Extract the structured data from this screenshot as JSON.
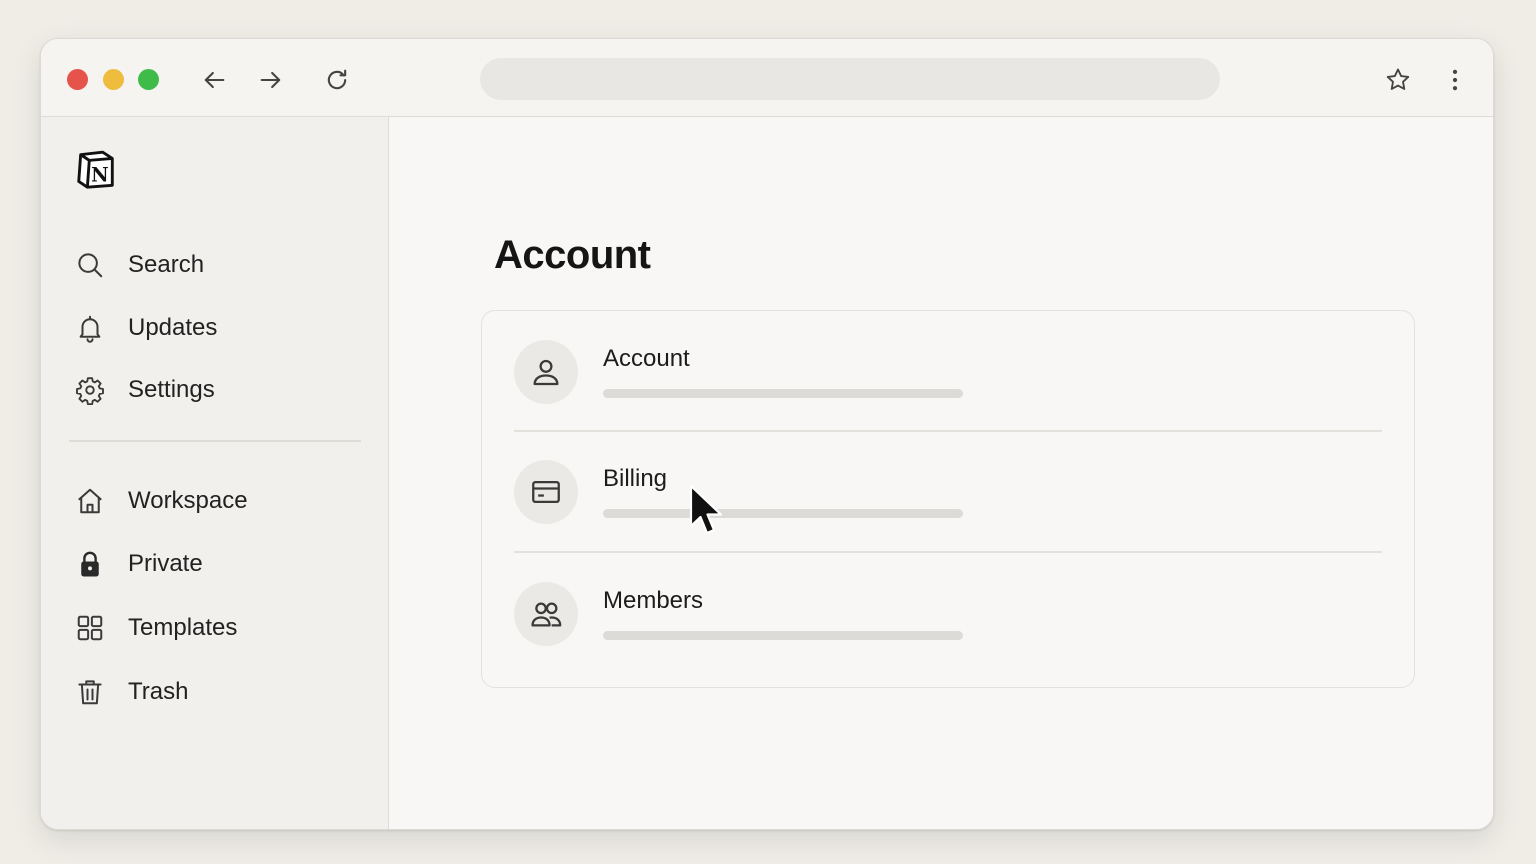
{
  "browser": {
    "traffic_lights": {
      "close": "#e5534b",
      "minimize": "#efbd3e",
      "maximize": "#3fbb4a"
    },
    "url": "",
    "icons": [
      "back-arrow-icon",
      "forward-arrow-icon",
      "reload-icon",
      "star-icon",
      "more-vertical-icon"
    ]
  },
  "sidebar": {
    "logo": "notion-logo",
    "top_items": [
      {
        "label": "Search",
        "icon": "search-icon"
      },
      {
        "label": "Updates",
        "icon": "bell-icon"
      },
      {
        "label": "Settings",
        "icon": "gear-icon"
      }
    ],
    "items": [
      {
        "label": "Workspace",
        "icon": "home-icon"
      },
      {
        "label": "Private",
        "icon": "lock-icon"
      },
      {
        "label": "Templates",
        "icon": "grid-icon"
      },
      {
        "label": "Trash",
        "icon": "trash-icon"
      }
    ]
  },
  "main": {
    "title": "Account",
    "rows": [
      {
        "label": "Account",
        "icon": "user-icon"
      },
      {
        "label": "Billing",
        "icon": "credit-card-icon"
      },
      {
        "label": "Members",
        "icon": "users-icon"
      }
    ]
  },
  "colors": {
    "background": "#efede6",
    "window": "#f8f7f5",
    "sidebar": "#f1f0ed",
    "text": "#1f1f1f"
  }
}
